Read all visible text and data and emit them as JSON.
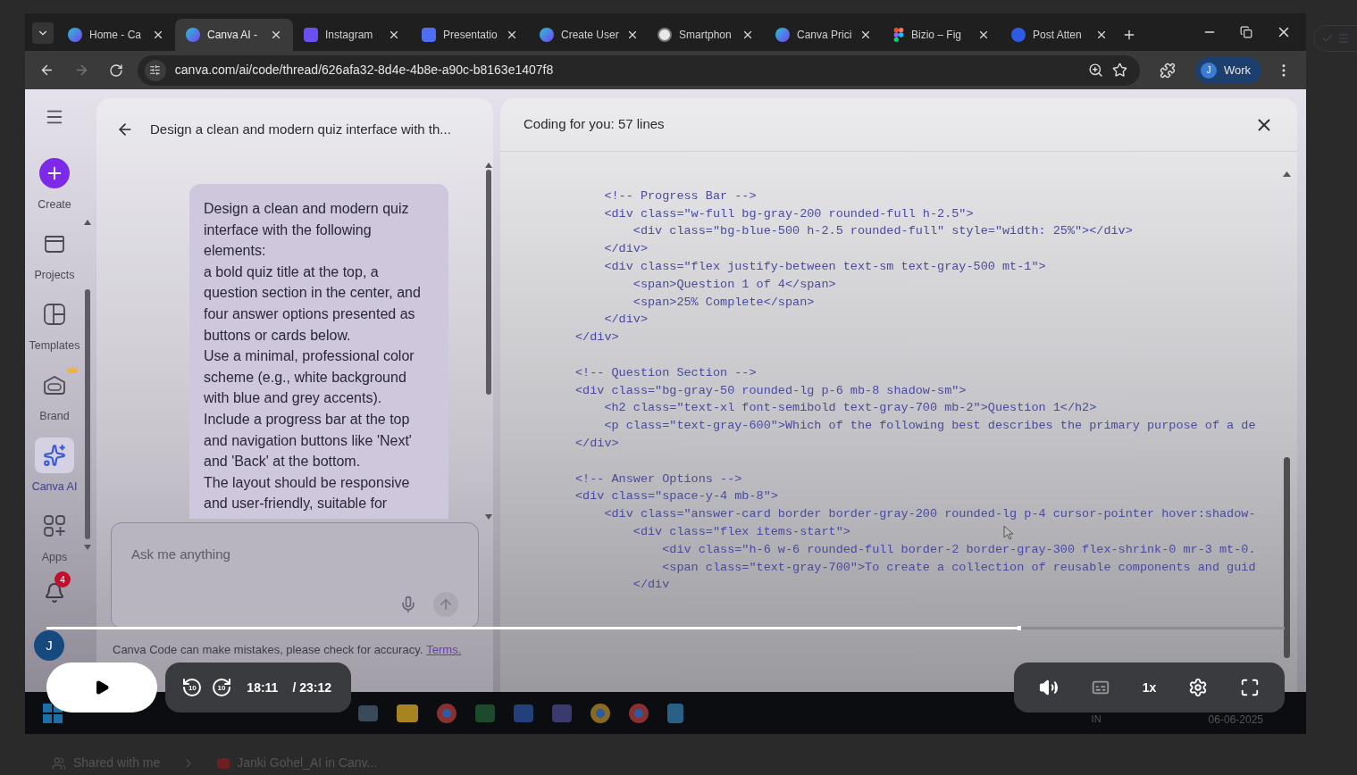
{
  "browser": {
    "tabs": [
      {
        "title": "Home - Ca",
        "kind": "canva",
        "selected": false
      },
      {
        "title": "Canva AI -",
        "kind": "canva",
        "selected": true
      },
      {
        "title": "Instagram",
        "kind": "heart",
        "selected": false
      },
      {
        "title": "Presentatio",
        "kind": "chat",
        "selected": false
      },
      {
        "title": "Create User",
        "kind": "canva",
        "selected": false
      },
      {
        "title": "Smartphon",
        "kind": "globe",
        "selected": false
      },
      {
        "title": "Canva Prici",
        "kind": "canva",
        "selected": false
      },
      {
        "title": "Bizio – Fig",
        "kind": "figma",
        "selected": false
      },
      {
        "title": "Post Atten",
        "kind": "zoom",
        "selected": false
      }
    ],
    "url": "canva.com/ai/code/thread/626afa32-8d4e-4b8e-a90c-b8163e1407f8",
    "profile": {
      "initial": "J",
      "label": "Work"
    }
  },
  "sidebar": {
    "items": [
      {
        "label": "Create",
        "kind": "create",
        "selected": false
      },
      {
        "label": "Projects",
        "kind": "projects",
        "selected": false
      },
      {
        "label": "Templates",
        "kind": "templates",
        "selected": false
      },
      {
        "label": "Brand",
        "kind": "brand",
        "selected": false
      },
      {
        "label": "Canva AI",
        "kind": "ai",
        "selected": true
      },
      {
        "label": "Apps",
        "kind": "apps",
        "selected": false
      }
    ],
    "notifications": {
      "count": "4"
    },
    "avatar": {
      "initial": "J"
    }
  },
  "chat": {
    "title": "Design a clean and modern quiz interface with th...",
    "message": "Design a clean and modern quiz interface with the following elements:\na bold quiz title at the top, a question section in the center, and four answer options presented as buttons or cards below.\nUse a minimal, professional color scheme (e.g., white background with blue and grey accents).\nInclude a progress bar at the top and navigation buttons like 'Next' and 'Back' at the bottom.\nThe layout should be responsive and user-friendly, suitable for",
    "input": {
      "placeholder": "Ask me anything"
    },
    "disclaimer": "Canva Code can make mistakes, please check for accuracy.",
    "terms_link": "Terms."
  },
  "code_panel": {
    "title": "Coding for you: 57 lines",
    "code_blocks": [
      [
        "    <!-- Progress Bar -->",
        "    <div class=\"w-full bg-gray-200 rounded-full h-2.5\">",
        "        <div class=\"bg-blue-500 h-2.5 rounded-full\" style=\"width: 25%\"></div>",
        "    </div>",
        "    <div class=\"flex justify-between text-sm text-gray-500 mt-1\">",
        "        <span>Question 1 of 4</span>",
        "        <span>25% Complete</span>",
        "    </div>",
        "</div>"
      ],
      [
        "<!-- Question Section -->",
        "<div class=\"bg-gray-50 rounded-lg p-6 mb-8 shadow-sm\">",
        "    <h2 class=\"text-xl font-semibold text-gray-700 mb-2\">Question 1</h2>",
        "    <p class=\"text-gray-600\">Which of the following best describes the primary purpose of a de",
        "</div>"
      ],
      [
        "<!-- Answer Options -->",
        "<div class=\"space-y-4 mb-8\">",
        "    <div class=\"answer-card border border-gray-200 rounded-lg p-4 cursor-pointer hover:shadow-",
        "        <div class=\"flex items-start\">",
        "            <div class=\"h-6 w-6 rounded-full border-2 border-gray-300 flex-shrink-0 mr-3 mt-0.",
        "            <span class=\"text-gray-700\">To create a collection of reusable components and guid",
        "        </div"
      ]
    ]
  },
  "taskbar": {
    "language": "IN",
    "date": "06-06-2025"
  },
  "player": {
    "progress": {
      "level": 0.784
    },
    "playing": false,
    "skip_back": "10",
    "skip_forward": "10",
    "current_time": "18:11",
    "duration": "/ 23:12",
    "speed": "1x"
  },
  "page": {
    "breadcrumb": [
      {
        "label": "Shared with me"
      },
      {
        "label": "Janki Gohel_AI in Canv..."
      }
    ]
  }
}
